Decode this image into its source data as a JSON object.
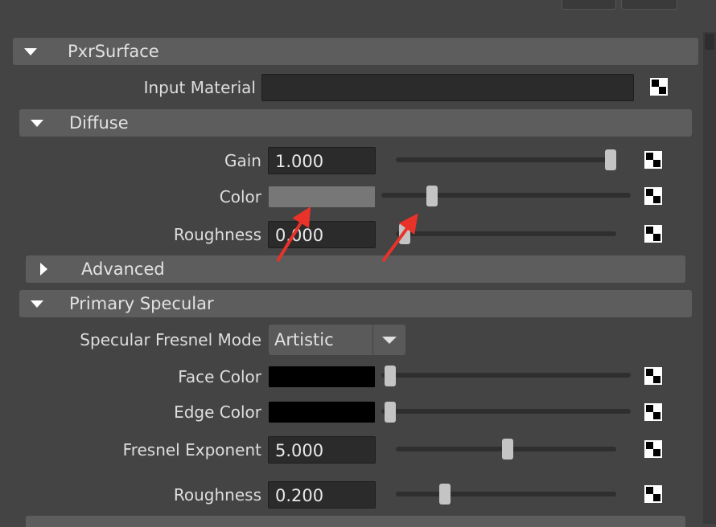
{
  "main_frame": {
    "title": "PxrSurface"
  },
  "input_material": {
    "label": "Input Material",
    "value": ""
  },
  "diffuse": {
    "title": "Diffuse",
    "gain": {
      "label": "Gain",
      "value": "1.000",
      "level": 1.0
    },
    "color": {
      "label": "Color",
      "swatch": "#777777",
      "level": 0.2
    },
    "roughness": {
      "label": "Roughness",
      "value": "0.000",
      "level": 0.0
    }
  },
  "advanced": {
    "title": "Advanced"
  },
  "primary_specular": {
    "title": "Primary Specular",
    "fresnel_mode": {
      "label": "Specular Fresnel Mode",
      "value": "Artistic"
    },
    "face_color": {
      "label": "Face Color",
      "swatch": "#000000",
      "level": 0.0
    },
    "edge_color": {
      "label": "Edge Color",
      "swatch": "#000000",
      "level": 0.0
    },
    "fresnel_exponent": {
      "label": "Fresnel Exponent",
      "value": "5.000",
      "level": 0.5
    },
    "roughness": {
      "label": "Roughness",
      "value": "0.200",
      "level": 0.2
    }
  },
  "annotation": {
    "arrow_color": "#e8322a"
  },
  "icons": {
    "map_button": "checker-map-icon",
    "collapse": "triangle-down-icon",
    "expand": "triangle-right-icon"
  }
}
